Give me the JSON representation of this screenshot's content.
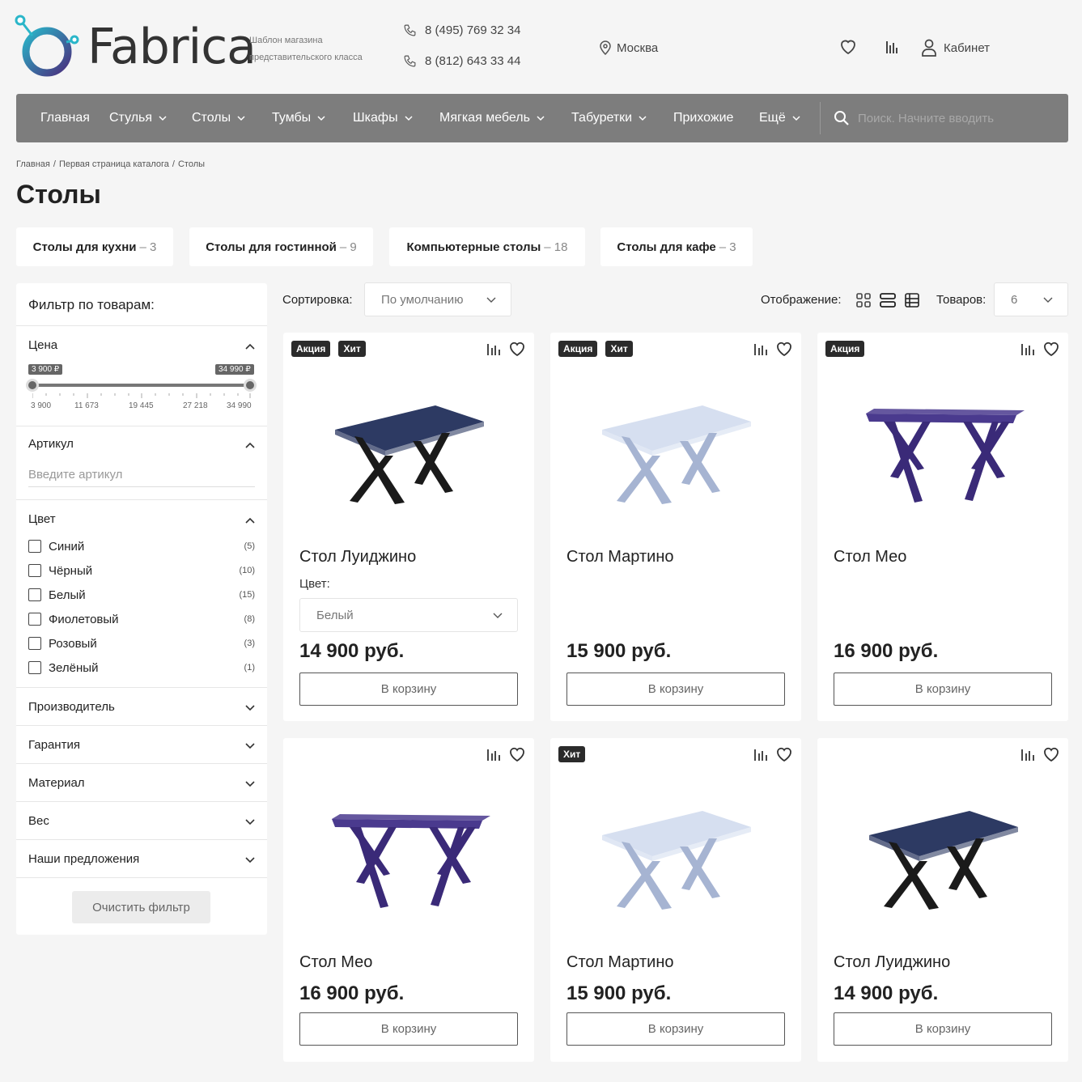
{
  "header": {
    "brand": "Fabrica",
    "tagline": "Шаблон магазина представительского класса",
    "phones": [
      "8 (495) 769 32 34",
      "8 (812) 643 33 44"
    ],
    "city": "Москва",
    "cabinet": "Кабинет"
  },
  "nav": {
    "items": [
      "Главная",
      "Стулья",
      "Столы",
      "Тумбы",
      "Шкафы",
      "Мягкая мебель",
      "Табуретки",
      "Прихожие",
      "Ещё"
    ],
    "search_placeholder": "Поиск. Начните вводить"
  },
  "breadcrumb": [
    "Главная",
    "Первая страница каталога",
    "Столы"
  ],
  "page_title": "Столы",
  "categories": [
    {
      "label": "Столы для кухни",
      "count": "– 3"
    },
    {
      "label": "Столы для гостинной",
      "count": "– 9"
    },
    {
      "label": "Компьютерные столы",
      "count": "– 18"
    },
    {
      "label": "Столы для кафе",
      "count": "– 3"
    }
  ],
  "filter": {
    "title": "Фильтр по товарам:",
    "price": {
      "label": "Цена",
      "min_tip": "3 900 ₽",
      "max_tip": "34 990 ₽",
      "ticks": [
        "3 900",
        "11 673",
        "19 445",
        "27 218",
        "34 990"
      ]
    },
    "article": {
      "label": "Артикул",
      "placeholder": "Введите артикул"
    },
    "color": {
      "label": "Цвет",
      "options": [
        {
          "label": "Синий",
          "count": "(5)"
        },
        {
          "label": "Чёрный",
          "count": "(10)"
        },
        {
          "label": "Белый",
          "count": "(15)"
        },
        {
          "label": "Фиолетовый",
          "count": "(8)"
        },
        {
          "label": "Розовый",
          "count": "(3)"
        },
        {
          "label": "Зелёный",
          "count": "(1)"
        }
      ]
    },
    "collapsed": [
      "Производитель",
      "Гарантия",
      "Материал",
      "Вес",
      "Наши предложения"
    ],
    "clear": "Очистить фильтр"
  },
  "toolbar": {
    "sort_label": "Сортировка:",
    "sort_value": "По умолчанию",
    "view_label": "Отображение:",
    "count_label": "Товаров:",
    "count_value": "6"
  },
  "products": [
    {
      "name": "Стол Луиджино",
      "badges": [
        "Акция",
        "Хит"
      ],
      "price": "14 900 руб.",
      "color_label": "Цвет:",
      "color_value": "Белый",
      "top": "#2d3a63",
      "legs": "#1a1a1a",
      "style": "x"
    },
    {
      "name": "Стол Мартино",
      "badges": [
        "Акция",
        "Хит"
      ],
      "price": "15 900 руб.",
      "top": "#d6dff0",
      "legs": "#a6b4d2",
      "style": "x"
    },
    {
      "name": "Стол Мео",
      "badges": [
        "Акция"
      ],
      "price": "16 900 руб.",
      "top": "#4a3a8e",
      "legs": "#3a2a78",
      "style": "flat"
    },
    {
      "name": "Стол Мео",
      "badges": [],
      "price": "16 900 руб.",
      "top": "#4a3a8e",
      "legs": "#3a2a78",
      "style": "flat"
    },
    {
      "name": "Стол Мартино",
      "badges": [
        "Хит"
      ],
      "price": "15 900 руб.",
      "top": "#d6dff0",
      "legs": "#a6b4d2",
      "style": "x"
    },
    {
      "name": "Стол Луиджино",
      "badges": [],
      "price": "14 900 руб.",
      "top": "#2d3a63",
      "legs": "#1a1a1a",
      "style": "x"
    }
  ],
  "cart_label": "В корзину"
}
